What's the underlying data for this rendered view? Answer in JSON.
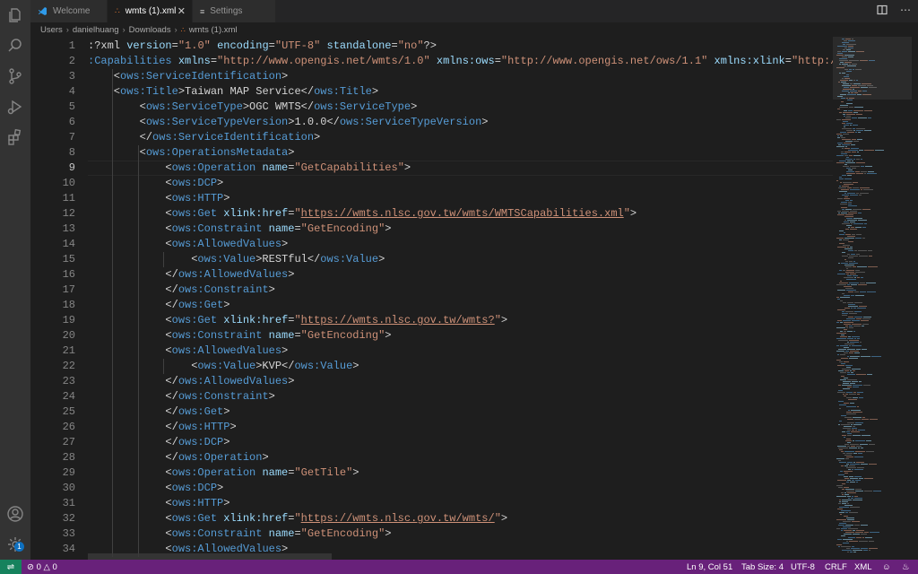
{
  "tabs": [
    {
      "label": "Welcome",
      "icon": "vscode-logo-icon",
      "active": false
    },
    {
      "label": "wmts (1).xml",
      "icon": "rss-icon",
      "active": true
    },
    {
      "label": "Settings",
      "icon": "settings-list-icon",
      "active": false
    }
  ],
  "breadcrumb": {
    "items": [
      "Users",
      "danielhuang",
      "Downloads",
      "wmts (1).xml"
    ]
  },
  "editor": {
    "current_line": 9,
    "lines": [
      {
        "n": "1"
      },
      {
        "n": "2"
      },
      {
        "n": "3"
      },
      {
        "n": "4"
      },
      {
        "n": "5"
      },
      {
        "n": "6"
      },
      {
        "n": "7"
      },
      {
        "n": "8"
      },
      {
        "n": "9"
      },
      {
        "n": "10"
      },
      {
        "n": "11"
      },
      {
        "n": "12"
      },
      {
        "n": "13"
      },
      {
        "n": "14"
      },
      {
        "n": "15"
      },
      {
        "n": "16"
      },
      {
        "n": "17"
      },
      {
        "n": "18"
      },
      {
        "n": "19"
      },
      {
        "n": "20"
      },
      {
        "n": "21"
      },
      {
        "n": "22"
      },
      {
        "n": "23"
      },
      {
        "n": "24"
      },
      {
        "n": "25"
      },
      {
        "n": "26"
      },
      {
        "n": "27"
      },
      {
        "n": "28"
      },
      {
        "n": "29"
      },
      {
        "n": "30"
      },
      {
        "n": "31"
      },
      {
        "n": "32"
      },
      {
        "n": "33"
      },
      {
        "n": "34"
      }
    ],
    "code": [
      [
        [
          "x",
          ":?xml "
        ],
        [
          "a",
          "version"
        ],
        [
          "x",
          "="
        ],
        [
          "s",
          "\"1.0\""
        ],
        [
          "x",
          " "
        ],
        [
          "a",
          "encoding"
        ],
        [
          "x",
          "="
        ],
        [
          "s",
          "\"UTF-8\""
        ],
        [
          "x",
          " "
        ],
        [
          "a",
          "standalone"
        ],
        [
          "x",
          "="
        ],
        [
          "s",
          "\"no\""
        ],
        [
          "x",
          "?>"
        ]
      ],
      [
        [
          "t",
          ":Capabilities "
        ],
        [
          "a",
          "xmlns"
        ],
        [
          "x",
          "="
        ],
        [
          "s",
          "\"http://www.opengis.net/wmts/1.0\""
        ],
        [
          "x",
          " "
        ],
        [
          "a",
          "xmlns:ows"
        ],
        [
          "x",
          "="
        ],
        [
          "s",
          "\"http://www.opengis.net/ows/1.1\""
        ],
        [
          "x",
          " "
        ],
        [
          "a",
          "xmlns:xlink"
        ],
        [
          "x",
          "="
        ],
        [
          "s",
          "\"http://www.w"
        ]
      ],
      [
        [
          "x",
          "    <"
        ],
        [
          "t",
          "ows:ServiceIdentification"
        ],
        [
          "x",
          ">"
        ]
      ],
      [
        [
          "x",
          "    <"
        ],
        [
          "t",
          "ows:Title"
        ],
        [
          "x",
          ">Taiwan MAP Service</"
        ],
        [
          "t",
          "ows:Title"
        ],
        [
          "x",
          ">"
        ]
      ],
      [
        [
          "x",
          "        <"
        ],
        [
          "t",
          "ows:ServiceType"
        ],
        [
          "x",
          ">OGC WMTS</"
        ],
        [
          "t",
          "ows:ServiceType"
        ],
        [
          "x",
          ">"
        ]
      ],
      [
        [
          "x",
          "        <"
        ],
        [
          "t",
          "ows:ServiceTypeVersion"
        ],
        [
          "x",
          ">1.0.0</"
        ],
        [
          "t",
          "ows:ServiceTypeVersion"
        ],
        [
          "x",
          ">"
        ]
      ],
      [
        [
          "x",
          "        </"
        ],
        [
          "t",
          "ows:ServiceIdentification"
        ],
        [
          "x",
          ">"
        ]
      ],
      [
        [
          "x",
          "        <"
        ],
        [
          "t",
          "ows:OperationsMetadata"
        ],
        [
          "x",
          ">"
        ]
      ],
      [
        [
          "x",
          "            <"
        ],
        [
          "t",
          "ows:Operation "
        ],
        [
          "a",
          "name"
        ],
        [
          "x",
          "="
        ],
        [
          "s",
          "\"GetCapabilities\""
        ],
        [
          "x",
          ">"
        ]
      ],
      [
        [
          "x",
          "            <"
        ],
        [
          "t",
          "ows:DCP"
        ],
        [
          "x",
          ">"
        ]
      ],
      [
        [
          "x",
          "            <"
        ],
        [
          "t",
          "ows:HTTP"
        ],
        [
          "x",
          ">"
        ]
      ],
      [
        [
          "x",
          "            <"
        ],
        [
          "t",
          "ows:Get "
        ],
        [
          "a",
          "xlink:href"
        ],
        [
          "x",
          "="
        ],
        [
          "s",
          "\""
        ],
        [
          "u",
          "https://wmts.nlsc.gov.tw/wmts/WMTSCapabilities.xml"
        ],
        [
          "s",
          "\""
        ],
        [
          "x",
          ">"
        ]
      ],
      [
        [
          "x",
          "            <"
        ],
        [
          "t",
          "ows:Constraint "
        ],
        [
          "a",
          "name"
        ],
        [
          "x",
          "="
        ],
        [
          "s",
          "\"GetEncoding\""
        ],
        [
          "x",
          ">"
        ]
      ],
      [
        [
          "x",
          "            <"
        ],
        [
          "t",
          "ows:AllowedValues"
        ],
        [
          "x",
          ">"
        ]
      ],
      [
        [
          "x",
          "                <"
        ],
        [
          "t",
          "ows:Value"
        ],
        [
          "x",
          ">RESTful</"
        ],
        [
          "t",
          "ows:Value"
        ],
        [
          "x",
          ">"
        ]
      ],
      [
        [
          "x",
          "            </"
        ],
        [
          "t",
          "ows:AllowedValues"
        ],
        [
          "x",
          ">"
        ]
      ],
      [
        [
          "x",
          "            </"
        ],
        [
          "t",
          "ows:Constraint"
        ],
        [
          "x",
          ">"
        ]
      ],
      [
        [
          "x",
          "            </"
        ],
        [
          "t",
          "ows:Get"
        ],
        [
          "x",
          ">"
        ]
      ],
      [
        [
          "x",
          "            <"
        ],
        [
          "t",
          "ows:Get "
        ],
        [
          "a",
          "xlink:href"
        ],
        [
          "x",
          "="
        ],
        [
          "s",
          "\""
        ],
        [
          "u",
          "https://wmts.nlsc.gov.tw/wmts?"
        ],
        [
          "s",
          "\""
        ],
        [
          "x",
          ">"
        ]
      ],
      [
        [
          "x",
          "            <"
        ],
        [
          "t",
          "ows:Constraint "
        ],
        [
          "a",
          "name"
        ],
        [
          "x",
          "="
        ],
        [
          "s",
          "\"GetEncoding\""
        ],
        [
          "x",
          ">"
        ]
      ],
      [
        [
          "x",
          "            <"
        ],
        [
          "t",
          "ows:AllowedValues"
        ],
        [
          "x",
          ">"
        ]
      ],
      [
        [
          "x",
          "                <"
        ],
        [
          "t",
          "ows:Value"
        ],
        [
          "x",
          ">KVP</"
        ],
        [
          "t",
          "ows:Value"
        ],
        [
          "x",
          ">"
        ]
      ],
      [
        [
          "x",
          "            </"
        ],
        [
          "t",
          "ows:AllowedValues"
        ],
        [
          "x",
          ">"
        ]
      ],
      [
        [
          "x",
          "            </"
        ],
        [
          "t",
          "ows:Constraint"
        ],
        [
          "x",
          ">"
        ]
      ],
      [
        [
          "x",
          "            </"
        ],
        [
          "t",
          "ows:Get"
        ],
        [
          "x",
          ">"
        ]
      ],
      [
        [
          "x",
          "            </"
        ],
        [
          "t",
          "ows:HTTP"
        ],
        [
          "x",
          ">"
        ]
      ],
      [
        [
          "x",
          "            </"
        ],
        [
          "t",
          "ows:DCP"
        ],
        [
          "x",
          ">"
        ]
      ],
      [
        [
          "x",
          "            </"
        ],
        [
          "t",
          "ows:Operation"
        ],
        [
          "x",
          ">"
        ]
      ],
      [
        [
          "x",
          "            <"
        ],
        [
          "t",
          "ows:Operation "
        ],
        [
          "a",
          "name"
        ],
        [
          "x",
          "="
        ],
        [
          "s",
          "\"GetTile\""
        ],
        [
          "x",
          ">"
        ]
      ],
      [
        [
          "x",
          "            <"
        ],
        [
          "t",
          "ows:DCP"
        ],
        [
          "x",
          ">"
        ]
      ],
      [
        [
          "x",
          "            <"
        ],
        [
          "t",
          "ows:HTTP"
        ],
        [
          "x",
          ">"
        ]
      ],
      [
        [
          "x",
          "            <"
        ],
        [
          "t",
          "ows:Get "
        ],
        [
          "a",
          "xlink:href"
        ],
        [
          "x",
          "="
        ],
        [
          "s",
          "\""
        ],
        [
          "u",
          "https://wmts.nlsc.gov.tw/wmts/"
        ],
        [
          "s",
          "\""
        ],
        [
          "x",
          ">"
        ]
      ],
      [
        [
          "x",
          "            <"
        ],
        [
          "t",
          "ows:Constraint "
        ],
        [
          "a",
          "name"
        ],
        [
          "x",
          "="
        ],
        [
          "s",
          "\"GetEncoding\""
        ],
        [
          "x",
          ">"
        ]
      ],
      [
        [
          "x",
          "            <"
        ],
        [
          "t",
          "ows:AllowedValues"
        ],
        [
          "x",
          ">"
        ]
      ]
    ]
  },
  "status": {
    "errors": "0",
    "warnings": "0",
    "position": "Ln 9, Col 51",
    "tab_size": "Tab Size: 4",
    "encoding": "UTF-8",
    "eol": "CRLF",
    "language": "XML"
  },
  "activity": {
    "accounts_badge": "1",
    "items": [
      "explorer-icon",
      "search-icon",
      "source-control-icon",
      "run-debug-icon",
      "extensions-icon",
      "accounts-icon",
      "manage-gear-icon"
    ]
  },
  "colors": {
    "statusbar": "#68217a",
    "remote": "#16825d",
    "tag": "#569cd6",
    "attribute": "#9cdcfe",
    "string": "#ce9178"
  }
}
